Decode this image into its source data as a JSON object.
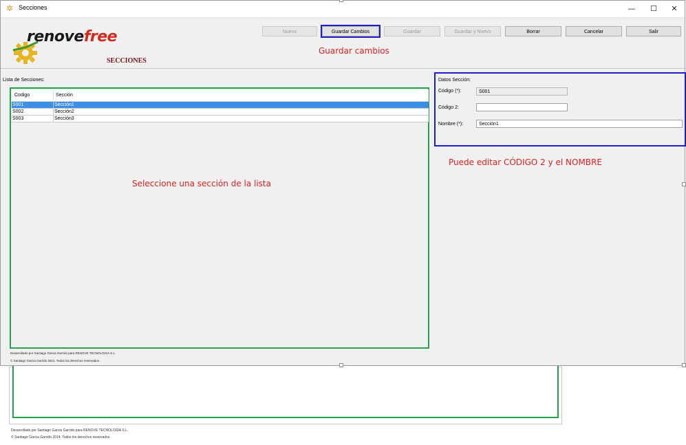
{
  "window": {
    "title": "Secciones",
    "min_glyph": "—",
    "max_glyph": "☐",
    "close_glyph": "✕"
  },
  "logo": {
    "part1": "renove",
    "part2": "free"
  },
  "section_title": "SECCIONES",
  "toolbar": {
    "nuevo": "Nuevo",
    "guardar_cambios": "Guardar Cambios",
    "guardar": "Guardar",
    "guardar_y_nuevo": "Guardar y Nuevo",
    "borrar": "Borrar",
    "cancelar": "Cancelar",
    "salir": "Salir"
  },
  "annotations": {
    "guardar": "Guardar cambios",
    "editar": "Puede editar CÓDIGO 2 y el NOMBRE",
    "seleccione": "Seleccione una sección de la lista"
  },
  "list": {
    "label": "Lista de Secciones:",
    "columns": [
      "Codigo",
      "Sección"
    ],
    "rows": [
      {
        "codigo": "S001",
        "seccion": "Sección1",
        "selected": true
      },
      {
        "codigo": "S002",
        "seccion": "Sección2",
        "selected": false
      },
      {
        "codigo": "S003",
        "seccion": "Sección3",
        "selected": false
      }
    ]
  },
  "details": {
    "title": "Datos Sección:",
    "codigo_label": "Código (*):",
    "codigo_value": "S001",
    "codigo2_label": "Código 2:",
    "codigo2_value": "",
    "nombre_label": "Nombre (*):",
    "nombre_value": "Sección1"
  },
  "footer": {
    "line1": "Desarrollado por Santiago Garcia Garrido para RENOVE TECNOLOGIA S.L.",
    "line2": "© Santiago Garcia Garrido 2014. Todos los derechos reservados."
  },
  "colors": {
    "highlight_blue": "#1e1ec8",
    "highlight_green": "#22a34a",
    "annotation_red": "#e02020",
    "selection_blue": "#3a8ee6"
  }
}
